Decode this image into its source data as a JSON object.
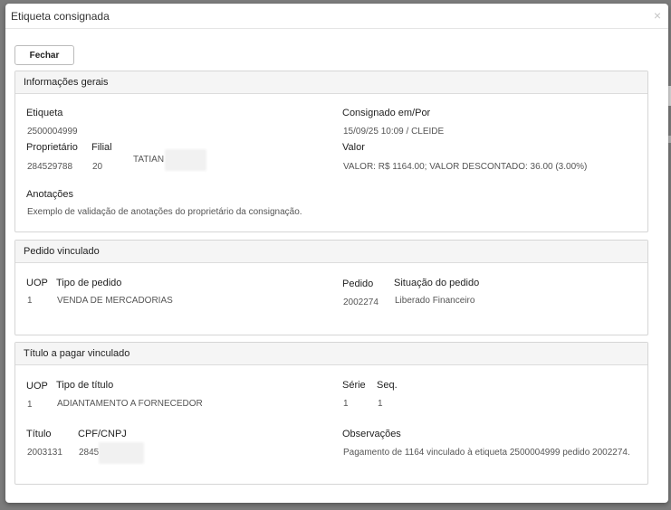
{
  "modal": {
    "title": "Etiqueta consignada",
    "close_glyph": "×",
    "close_button_label": "Fechar"
  },
  "info_gerais": {
    "heading": "Informações gerais",
    "etiqueta_label": "Etiqueta",
    "etiqueta_value": "2500004999",
    "consignado_label": "Consignado em/Por",
    "consignado_value": "15/09/25 10:09 / CLEIDE",
    "proprietario_label": "Proprietário",
    "proprietario_value": "284529788",
    "filial_label": "Filial",
    "filial_value": "20",
    "proprietario_nome": "TATIAN",
    "valor_label": "Valor",
    "valor_value": "VALOR: R$ 1164.00; VALOR DESCONTADO: 36.00 (3.00%)",
    "anotacoes_label": "Anotações",
    "anotacoes_value": "Exemplo de validação de anotações do proprietário da consignação."
  },
  "pedido": {
    "heading": "Pedido vinculado",
    "uop_label": "UOP",
    "uop_value": "1",
    "tipo_label": "Tipo de pedido",
    "tipo_value": "VENDA DE MERCADORIAS",
    "pedido_label": "Pedido",
    "pedido_value": "2002274",
    "situacao_label": "Situação do pedido",
    "situacao_value": "Liberado Financeiro"
  },
  "titulo": {
    "heading": "Título a pagar vinculado",
    "uop_label": "UOP",
    "uop_value": "1",
    "tipo_label": "Tipo de título",
    "tipo_value": "ADIANTAMENTO A FORNECEDOR",
    "serie_label": "Série",
    "serie_value": "1",
    "seq_label": "Seq.",
    "seq_value": "1",
    "titulo_label": "Título",
    "titulo_value": "2003131",
    "cpf_label": "CPF/CNPJ",
    "cpf_value": "2845",
    "obs_label": "Observações",
    "obs_value": "Pagamento de 1164 vinculado à etiqueta 2500004999 pedido 2002274."
  }
}
